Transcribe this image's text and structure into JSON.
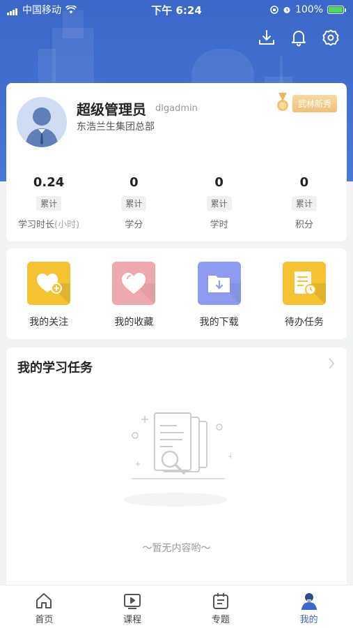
{
  "status_bar": {
    "carrier": "中国移动",
    "time": "下午 6:24",
    "battery": "100%"
  },
  "profile": {
    "name": "超级管理员",
    "username": "dlgadmin",
    "organization": "东浩兰生集团总部",
    "badge": "武林新秀"
  },
  "stats": [
    {
      "value": "0.24",
      "tag": "累计",
      "label": "学习时长",
      "sublabel": "(小时)"
    },
    {
      "value": "0",
      "tag": "累计",
      "label": "学分",
      "sublabel": ""
    },
    {
      "value": "0",
      "tag": "累计",
      "label": "学时",
      "sublabel": ""
    },
    {
      "value": "0",
      "tag": "累计",
      "label": "积分",
      "sublabel": ""
    }
  ],
  "quick_actions": [
    {
      "label": "我的关注",
      "icon": "heart-plus-icon",
      "color": "#f5c232"
    },
    {
      "label": "我的收藏",
      "icon": "heart-icon",
      "color": "#f0a8b0"
    },
    {
      "label": "我的下载",
      "icon": "folder-download-icon",
      "color": "#8e9bf0"
    },
    {
      "label": "待办任务",
      "icon": "task-clock-icon",
      "color": "#f5c232"
    }
  ],
  "tasks": {
    "title": "我的学习任务",
    "empty_text": "～暂无内容哟～"
  },
  "tabbar": [
    {
      "label": "首页",
      "icon": "home-icon"
    },
    {
      "label": "课程",
      "icon": "play-icon"
    },
    {
      "label": "专题",
      "icon": "topic-icon"
    },
    {
      "label": "我的",
      "icon": "user-icon",
      "active": true
    }
  ]
}
